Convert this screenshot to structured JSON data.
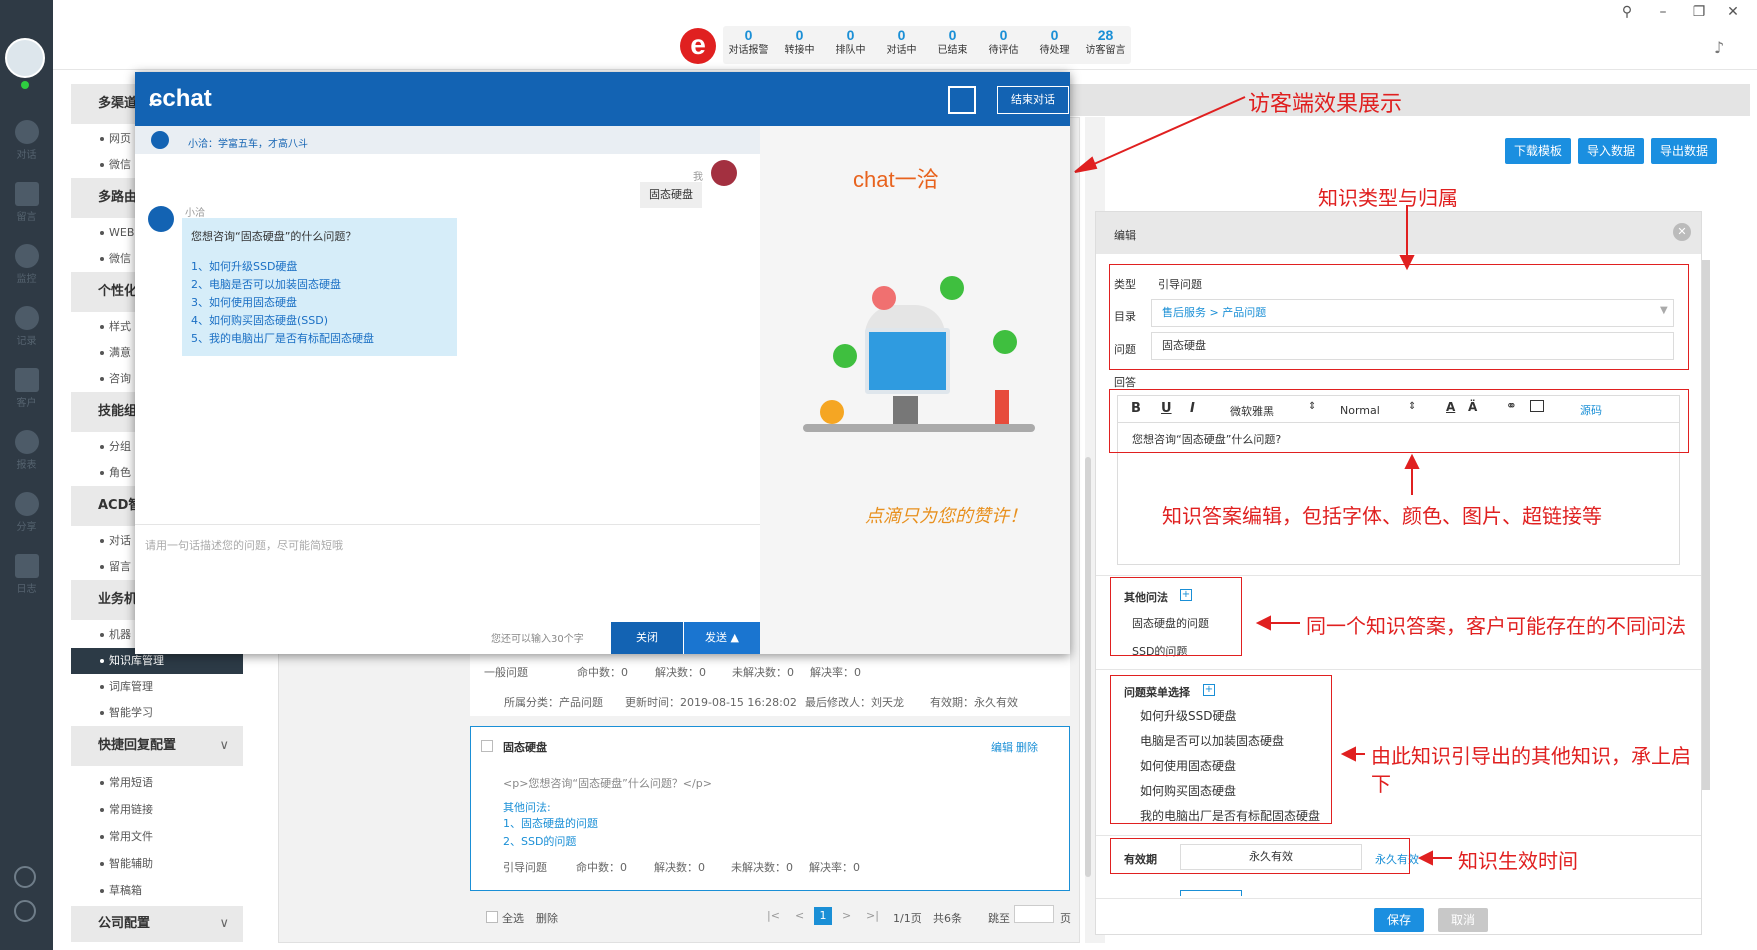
{
  "sidebar": {
    "items": [
      {
        "label": "对话",
        "icon": "chat-icon"
      },
      {
        "label": "留言",
        "icon": "mail-icon"
      },
      {
        "label": "监控",
        "icon": "eye-icon"
      },
      {
        "label": "记录",
        "icon": "clock-icon"
      },
      {
        "label": "客户",
        "icon": "contact-card-icon"
      },
      {
        "label": "报表",
        "icon": "pie-chart-icon"
      },
      {
        "label": "分享",
        "icon": "share-icon"
      },
      {
        "label": "日志",
        "icon": "log-icon"
      }
    ]
  },
  "topbar": {
    "logo": "e",
    "stats": [
      {
        "value": "0",
        "label": "对话报警"
      },
      {
        "value": "0",
        "label": "转接中"
      },
      {
        "value": "0",
        "label": "排队中"
      },
      {
        "value": "0",
        "label": "对话中"
      },
      {
        "value": "0",
        "label": "已结束"
      },
      {
        "value": "0",
        "label": "待评估"
      },
      {
        "value": "0",
        "label": "待处理"
      },
      {
        "value": "28",
        "label": "访客留言"
      }
    ]
  },
  "menu": {
    "heads": [
      "多渠道",
      "多路由",
      "个性化",
      "技能组",
      "ACD智",
      "业务机",
      "快捷回复配置",
      "公司配置"
    ],
    "subs": [
      "网页",
      "微信",
      "WEB",
      "微信",
      "样式",
      "满意",
      "咨询",
      "分组",
      "角色",
      "对话",
      "留言",
      "机器",
      "知识库管理",
      "词库管理",
      "智能学习",
      "常用短语",
      "常用链接",
      "常用文件",
      "智能辅助",
      "草稿箱"
    ]
  },
  "actions": {
    "download": "下载模板",
    "import": "导入数据",
    "export": "导出数据"
  },
  "list": {
    "row1": {
      "type": "一般问题",
      "hits": "命中数：0",
      "solved": "解决数：0",
      "unsolved": "未解决数：0",
      "rate": "解决率：0",
      "category": "所属分类：产品问题",
      "updated": "更新时间：2019-08-15 16:28:02",
      "modifier": "最后修改人：刘天龙",
      "validity": "有效期：永久有效"
    },
    "card": {
      "title": "固态硬盘",
      "edit": "编辑",
      "delete": "删除",
      "content": "<p>您想咨询“固态硬盘”什么问题？</p>",
      "other_label": "其他问法:",
      "other1": "1、固态硬盘的问题",
      "other2": "2、SSD的问题",
      "type": "引导问题",
      "hits": "命中数：0",
      "solved": "解决数：0",
      "unsolved": "未解决数：0",
      "rate": "解决率：0"
    },
    "footer": {
      "select_all": "全选",
      "delete": "删除",
      "page": "1",
      "pages": "1/1页",
      "total": "共6条",
      "jump": "跳至",
      "unit": "页"
    }
  },
  "editor": {
    "title": "编辑",
    "type_label": "类型",
    "type_value": "引导问题",
    "dir_label": "目录",
    "dir_value": "售后服务 > 产品问题",
    "q_label": "问题",
    "q_value": "固态硬盘",
    "answer_label": "回答",
    "toolbar": {
      "bold": "B",
      "underline": "U",
      "italic": "I",
      "font": "微软雅黑",
      "size": "Normal",
      "source": "源码"
    },
    "answer_text": "您想咨询“固态硬盘”什么问题?",
    "other_label": "其他问法",
    "other": [
      "固态硬盘的问题",
      "SSD的问题"
    ],
    "menu_label": "问题菜单选择",
    "menu_items": [
      "如何升级SSD硬盘",
      "电脑是否可以加装固态硬盘",
      "如何使用固态硬盘",
      "如何购买固态硬盘",
      "我的电脑出厂是否有标配固态硬盘"
    ],
    "valid_label": "有效期",
    "valid_value": "永久有效",
    "valid_link": "永久有效",
    "save": "保存",
    "cancel": "取消"
  },
  "chat": {
    "logo": "chat",
    "end_button": "结束对话",
    "bot_intro": "小洽：学富五车，才高八斗",
    "me_label": "我",
    "user_message": "固态硬盘",
    "bot_name": "小洽",
    "bot_question": "您想咨询“固态硬盘”的什么问题？",
    "options": [
      "1、如何升级SSD硬盘",
      "2、电脑是否可以加装固态硬盘",
      "3、如何使用固态硬盘",
      "4、如何购买固态硬盘(SSD)",
      "5、我的电脑出厂是否有标配固态硬盘"
    ],
    "input_placeholder": "请用一句话描述您的问题，尽可能简短哦",
    "char_hint": "您还可以输入30个字",
    "close": "关闭",
    "send": "发送",
    "brand": "chat一洽",
    "slogan": "点滴只为您的赞许！"
  },
  "annotations": {
    "visitor": "访客端效果展示",
    "type": "知识类型与归属",
    "answer": "知识答案编辑，包括字体、颜色、图片、超链接等",
    "other": "同一个知识答案，客户可能存在的不同问法",
    "menu1": "由此知识引导出的其他知识，承上启",
    "menu2": "下",
    "valid": "知识生效时间"
  }
}
